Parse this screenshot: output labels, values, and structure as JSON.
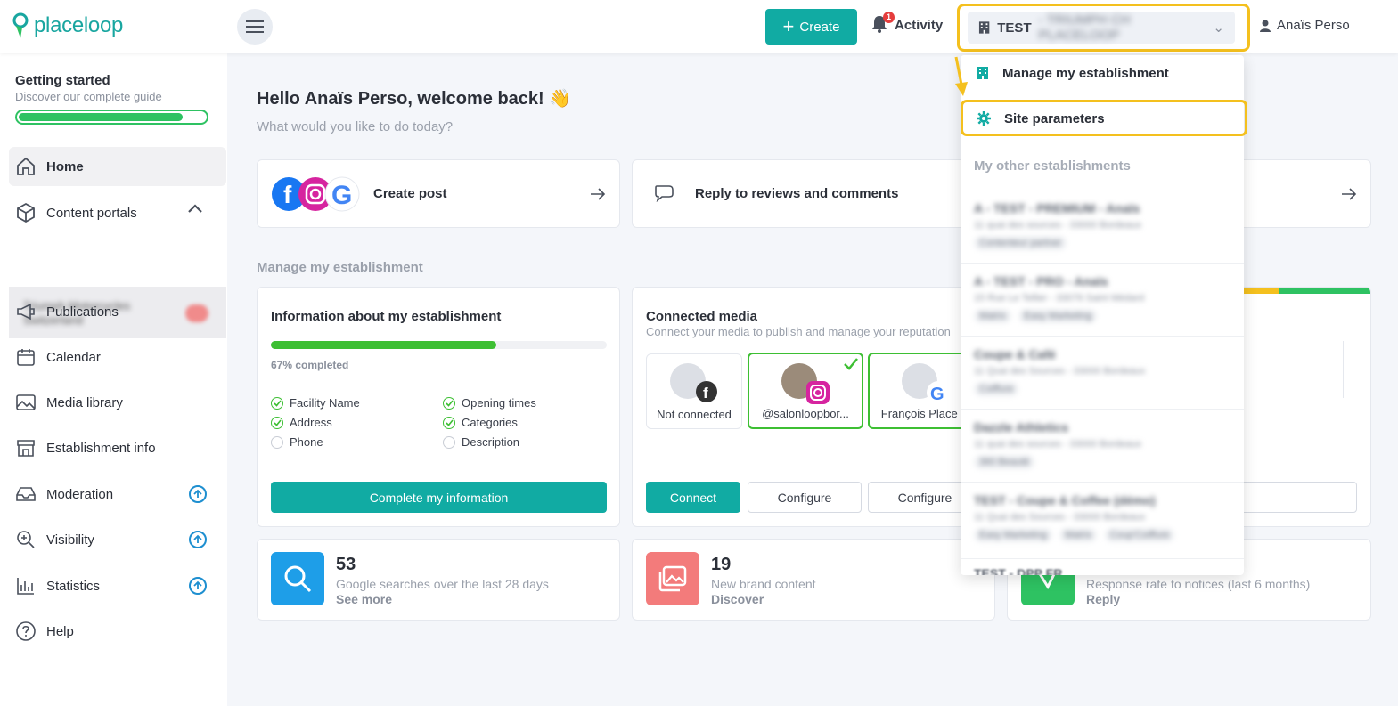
{
  "header": {
    "logo_text": "placeloop",
    "create_label": "Create",
    "activity_label": "Activity",
    "activity_badge": "1",
    "establishment_prefix": "TEST",
    "establishment_name_blurred": "- TRIUMPH CH PLACELOOP",
    "user_name": "Anaïs Perso"
  },
  "sidebar": {
    "getting_started_title": "Getting started",
    "getting_started_sub": "Discover our complete guide",
    "getting_started_progress": 0.88,
    "items": [
      {
        "label": "Home",
        "icon": "home-icon"
      },
      {
        "label": "Content portals",
        "icon": "cube-icon"
      },
      {
        "label": "Publications",
        "icon": "megaphone-icon"
      },
      {
        "label": "Calendar",
        "icon": "calendar-icon"
      },
      {
        "label": "Media library",
        "icon": "image-icon"
      },
      {
        "label": "Establishment info",
        "icon": "store-icon"
      },
      {
        "label": "Moderation",
        "icon": "inbox-icon"
      },
      {
        "label": "Visibility",
        "icon": "zoom-icon"
      },
      {
        "label": "Statistics",
        "icon": "bar-chart-icon"
      },
      {
        "label": "Help",
        "icon": "help-icon"
      }
    ],
    "portal_blurred": "Triumph Motorcycles Switzerland"
  },
  "main": {
    "welcome": "Hello Anaïs Perso, welcome back! 👋",
    "welcome_sub": "What would you like to do today?",
    "quick_actions": [
      {
        "label": "Create post"
      },
      {
        "label": "Reply to reviews and comments"
      }
    ],
    "section_label": "Manage my establishment",
    "info_card": {
      "title": "Information about my establishment",
      "progress": 0.67,
      "progress_label": "67% completed",
      "checks": [
        {
          "label": "Facility Name",
          "done": true
        },
        {
          "label": "Opening times",
          "done": true
        },
        {
          "label": "Address",
          "done": true
        },
        {
          "label": "Categories",
          "done": true
        },
        {
          "label": "Phone",
          "done": false
        },
        {
          "label": "Description",
          "done": false
        }
      ],
      "button": "Complete my information"
    },
    "media_card": {
      "title": "Connected media",
      "subtitle": "Connect your media to publish and manage your reputation",
      "items": [
        {
          "label": "Not connected"
        },
        {
          "label": "@salonloopbor..."
        },
        {
          "label": "François Place ..."
        }
      ],
      "connect": "Connect",
      "configure": "Configure"
    },
    "stats": [
      {
        "number": "53",
        "desc": "Google searches over the last 28 days",
        "link": "See more",
        "color": "#1e9ee8"
      },
      {
        "number": "19",
        "desc": "New brand content",
        "link": "Discover",
        "color": "#f37b7b"
      },
      {
        "number": "",
        "desc": "Response rate to notices (last 6 months)",
        "link": "Reply",
        "color": "#2ec262"
      }
    ]
  },
  "dropdown": {
    "manage": "Manage my establishment",
    "site_params": "Site parameters",
    "section": "My other establishments",
    "establishments": [
      {
        "name": "A - TEST - PREMIUM - Anaïs",
        "addr": "11 quai des sources - 33000 Bordeaux",
        "tags": [
          "Contenteur partner"
        ]
      },
      {
        "name": "A - TEST - PRO - Anaïs",
        "addr": "15 Rue Le Tellier - 33076 Saint Médard",
        "tags": [
          "Matrix",
          "Easy Marketing"
        ]
      },
      {
        "name": "Coupe & Café",
        "addr": "11 Quai des Sources - 33000 Bordeaux",
        "tags": [
          "Coiffure"
        ]
      },
      {
        "name": "Dazzle Athletics",
        "addr": "11 quai des sources - 33000 Bordeaux",
        "tags": [
          "360 Beauté"
        ]
      },
      {
        "name": "TEST - Coupe & Coffee (démo)",
        "addr": "11 Quai des Sources - 33000 Bordeaux",
        "tags": [
          "Easy Marketing",
          "Matrix",
          "Coup'Coiffure"
        ]
      },
      {
        "name": "TEST - DPP FR",
        "addr": "",
        "tags": []
      }
    ]
  },
  "colors": {
    "teal": "#11aba3",
    "highlight": "#f4c01e",
    "green": "#3dbf33"
  }
}
